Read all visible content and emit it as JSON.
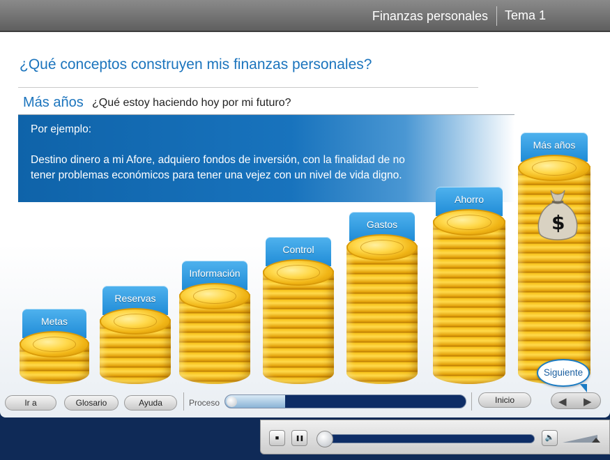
{
  "header": {
    "course_title": "Finanzas personales",
    "topic": "Tema 1"
  },
  "content": {
    "title": "¿Qué conceptos construyen mis finanzas personales?",
    "section_label": "Más años",
    "section_question": "¿Qué estoy haciendo hoy por mi futuro?",
    "example_heading": "Por ejemplo:",
    "example_text": "Destino dinero a mi Afore, adquiero fondos de inversión, con la finalidad de no tener problemas económicos para tener una vejez con un nivel de vida digno."
  },
  "stacks": [
    {
      "label": "Metas"
    },
    {
      "label": "Reservas"
    },
    {
      "label": "Información"
    },
    {
      "label": "Control"
    },
    {
      "label": "Gastos"
    },
    {
      "label": "Ahorro"
    },
    {
      "label": "Más años"
    }
  ],
  "controls": {
    "ir_a": "Ir a",
    "glosario": "Glosario",
    "ayuda": "Ayuda",
    "proceso_label": "Proceso",
    "progress_fraction": 0.25,
    "inicio": "Inicio",
    "prev_arrow": "◀",
    "next_arrow": "▶",
    "siguiente": "Siguiente"
  },
  "player": {
    "stop_icon": "■",
    "pause_icon": "❚❚",
    "speaker_icon": "🔈"
  },
  "colors": {
    "accent_blue": "#1b74bd",
    "info_box": "#1873bd",
    "label_tab": "#2a95dc",
    "coin_gold": "#f7c21a",
    "header_gray": "#6e6e6e"
  }
}
